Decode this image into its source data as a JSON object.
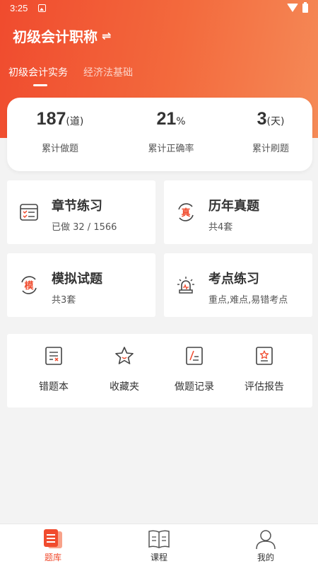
{
  "status_bar": {
    "time": "3:25"
  },
  "header": {
    "title": "初级会计职称",
    "swap_symbol": "⇌"
  },
  "tabs": [
    {
      "label": "初级会计实务",
      "active": true
    },
    {
      "label": "经济法基础",
      "active": false
    }
  ],
  "stats": [
    {
      "value": "187",
      "unit": "(道)",
      "label": "累计做题"
    },
    {
      "value": "21",
      "unit": "%",
      "label": "累计正确率"
    },
    {
      "value": "3",
      "unit": "(天)",
      "label": "累计刷题"
    }
  ],
  "cards": [
    {
      "title": "章节练习",
      "subtitle": "已做 32 / 1566",
      "icon": "checklist-icon"
    },
    {
      "title": "历年真题",
      "subtitle": "共4套",
      "icon": "real-exam-icon",
      "badge": "真"
    },
    {
      "title": "模拟试题",
      "subtitle": "共3套",
      "icon": "mock-exam-icon",
      "badge": "模"
    },
    {
      "title": "考点练习",
      "subtitle": "重点,难点,易错考点",
      "icon": "alarm-icon"
    }
  ],
  "tools": [
    {
      "label": "错题本",
      "icon": "wrong-book-icon"
    },
    {
      "label": "收藏夹",
      "icon": "star-icon"
    },
    {
      "label": "做题记录",
      "icon": "record-icon"
    },
    {
      "label": "评估报告",
      "icon": "report-icon"
    }
  ],
  "bottom_nav": [
    {
      "label": "题库",
      "active": true,
      "icon": "question-bank-icon"
    },
    {
      "label": "课程",
      "active": false,
      "icon": "book-icon"
    },
    {
      "label": "我的",
      "active": false,
      "icon": "person-icon"
    }
  ],
  "colors": {
    "accent": "#f04b2e",
    "accent_light": "#f58a57",
    "background": "#f3f3f3"
  }
}
